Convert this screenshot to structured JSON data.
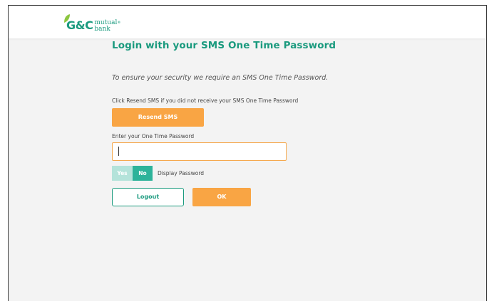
{
  "brand": {
    "logo_main": "G&C",
    "logo_line1": "mutual",
    "logo_line2": "bank",
    "leaf_color": "#8cc63f",
    "primary_color": "#1a9a7e",
    "accent_color": "#f9a544"
  },
  "page": {
    "title": "Login with your SMS One Time Password",
    "intro": "To ensure your security we require an SMS One Time Password."
  },
  "resend": {
    "label": "Click Resend SMS if you did not receive your SMS One Time Password",
    "button_label": "Resend SMS"
  },
  "otp": {
    "label": "Enter your One Time Password",
    "value": "",
    "placeholder": ""
  },
  "display_password": {
    "yes_label": "Yes",
    "no_label": "No",
    "selected": "No",
    "label": "Display Password"
  },
  "actions": {
    "logout_label": "Logout",
    "ok_label": "OK"
  }
}
